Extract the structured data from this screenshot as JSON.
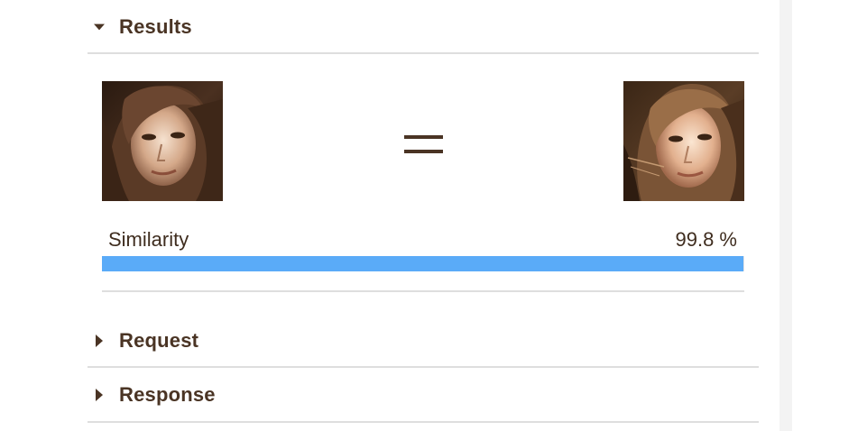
{
  "results": {
    "title": "Results",
    "expanded": true,
    "left_image": "face-photo-left",
    "right_image": "face-photo-right",
    "equals_symbol": "=",
    "similarity_label": "Similarity",
    "similarity_value": "99.8 %",
    "similarity_fraction": 0.998
  },
  "request": {
    "title": "Request",
    "expanded": false
  },
  "response": {
    "title": "Response",
    "expanded": false
  },
  "colors": {
    "text": "#4a3424",
    "progress": "#5aabf8",
    "divider": "#dedede"
  }
}
